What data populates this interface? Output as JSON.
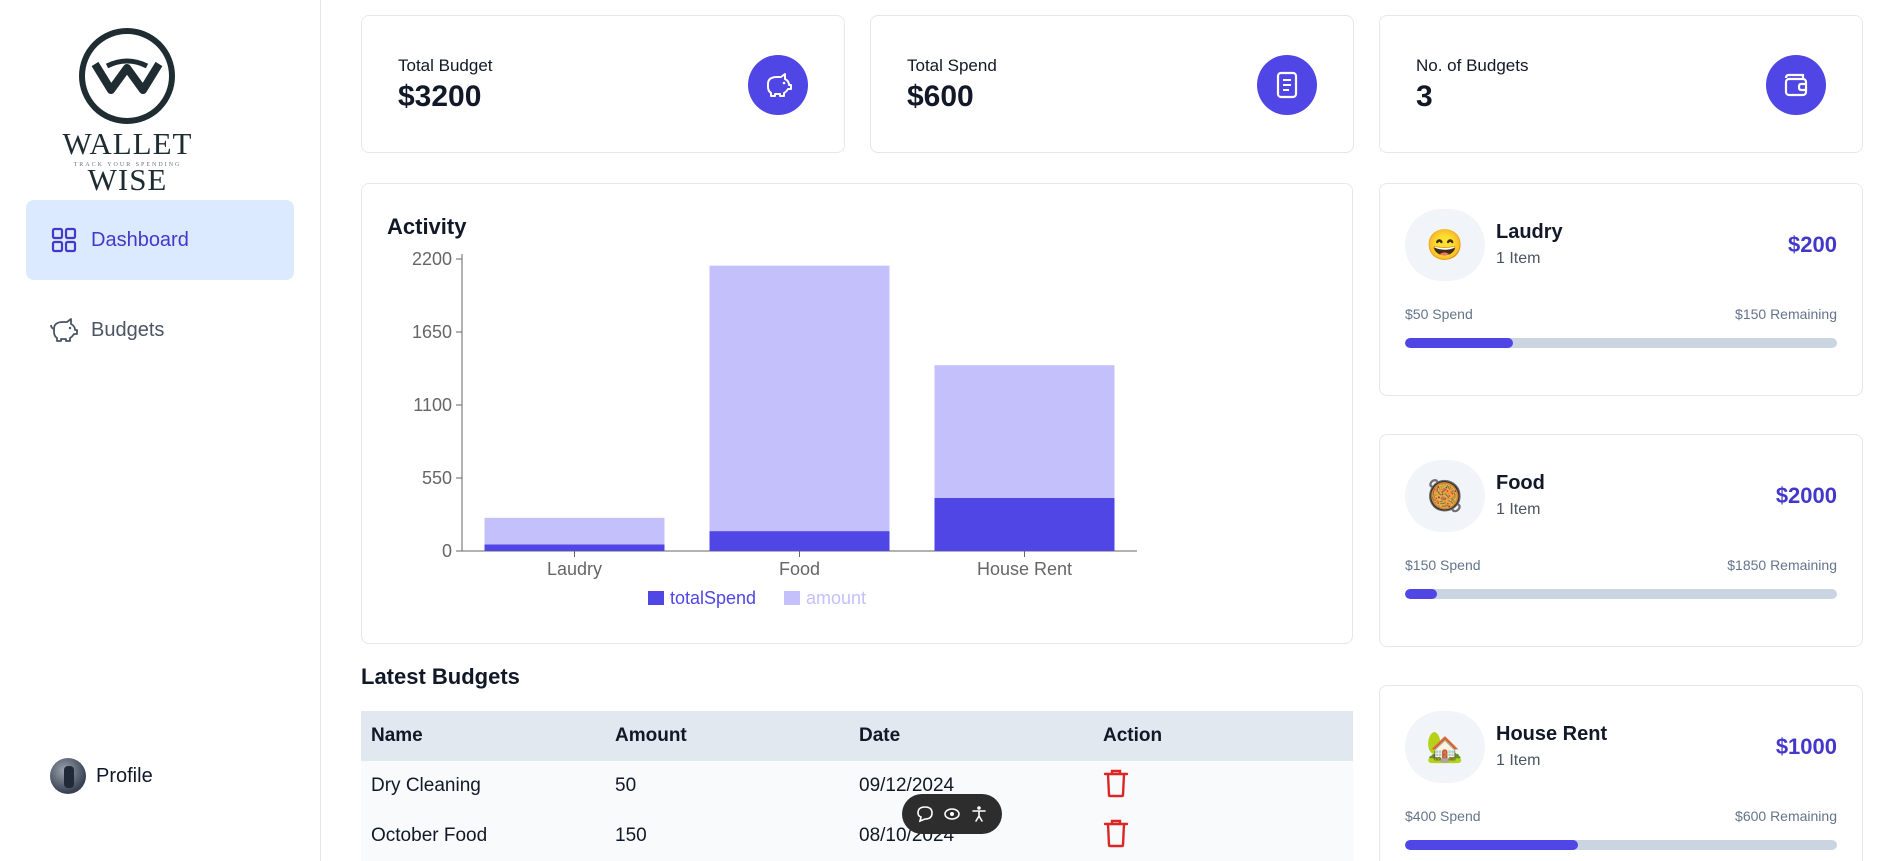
{
  "sidebar": {
    "logo_text": "WALLET WISE",
    "logo_tagline": "TRACK YOUR SPENDING",
    "items": [
      {
        "label": "Dashboard",
        "icon": "grid-icon",
        "active": true
      },
      {
        "label": "Budgets",
        "icon": "piggy-bank-icon",
        "active": false
      }
    ],
    "profile_label": "Profile"
  },
  "stats": [
    {
      "label": "Total Budget",
      "value": "$3200",
      "icon": "piggy-bank-icon"
    },
    {
      "label": "Total Spend",
      "value": "$600",
      "icon": "receipt-icon"
    },
    {
      "label": "No. of Budgets",
      "value": "3",
      "icon": "wallet-icon"
    }
  ],
  "activity": {
    "title": "Activity"
  },
  "chart_data": {
    "type": "bar",
    "stacked": true,
    "categories": [
      "Laudry",
      "Food",
      "House Rent"
    ],
    "series": [
      {
        "name": "totalSpend",
        "values": [
          50,
          150,
          400
        ],
        "color": "#4f46e5"
      },
      {
        "name": "amount",
        "values": [
          200,
          2000,
          1000
        ],
        "color": "#c3c0fb"
      }
    ],
    "yticks": [
      "0",
      "550",
      "1100",
      "1650",
      "2200"
    ],
    "ylim": [
      0,
      2200
    ],
    "legend_position": "bottom"
  },
  "latest": {
    "title": "Latest Budgets",
    "columns": [
      "Name",
      "Amount",
      "Date",
      "Action"
    ],
    "rows": [
      {
        "name": "Dry Cleaning",
        "amount": "50",
        "date": "09/12/2024"
      },
      {
        "name": "October Food",
        "amount": "150",
        "date": "08/10/2024"
      }
    ]
  },
  "budgets": [
    {
      "emoji": "😄",
      "name": "Laudry",
      "items": "1 Item",
      "amount": "$200",
      "spend": "$50 Spend",
      "remaining": "$150 Remaining",
      "progress": 0.25
    },
    {
      "emoji": "🥘",
      "name": "Food",
      "items": "1 Item",
      "amount": "$2000",
      "spend": "$150 Spend",
      "remaining": "$1850 Remaining",
      "progress": 0.075
    },
    {
      "emoji": "🏡",
      "name": "House Rent",
      "items": "1 Item",
      "amount": "$1000",
      "spend": "$400 Spend",
      "remaining": "$600 Remaining",
      "progress": 0.4
    }
  ],
  "colors": {
    "accent": "#4f46e5",
    "accent_light": "#c3c0fb",
    "active_nav_bg": "#dbeafe",
    "delete": "#dc2626"
  }
}
